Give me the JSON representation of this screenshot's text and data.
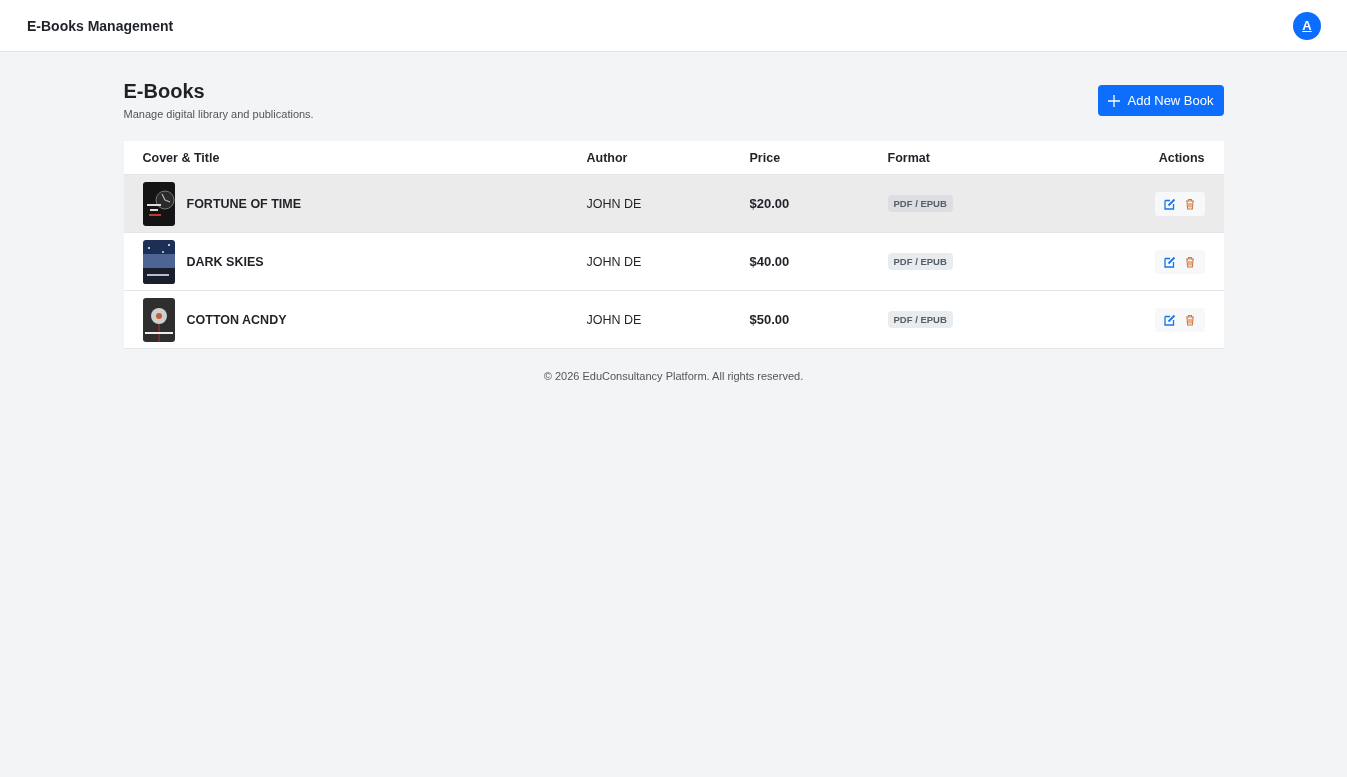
{
  "app_bar": {
    "title": "E-Books Management",
    "avatar": "A"
  },
  "header": {
    "title": "E-Books",
    "subtitle": "Manage digital library and publications.",
    "add_button": "Add New Book"
  },
  "table": {
    "columns": [
      "Cover & Title",
      "Author",
      "Price",
      "Format",
      "Actions"
    ],
    "rows": [
      {
        "title": "FORTUNE OF TIME",
        "author": "JOHN DE",
        "price": "$20.00",
        "format": "PDF / EPUB",
        "selected": true
      },
      {
        "title": "DARK SKIES",
        "author": "JOHN DE",
        "price": "$40.00",
        "format": "PDF / EPUB",
        "selected": false
      },
      {
        "title": "COTTON ACNDY",
        "author": "JOHN DE",
        "price": "$50.00",
        "format": "PDF / EPUB",
        "selected": false
      }
    ]
  },
  "footer": "© 2026 EduConsultancy Platform. All rights reserved."
}
